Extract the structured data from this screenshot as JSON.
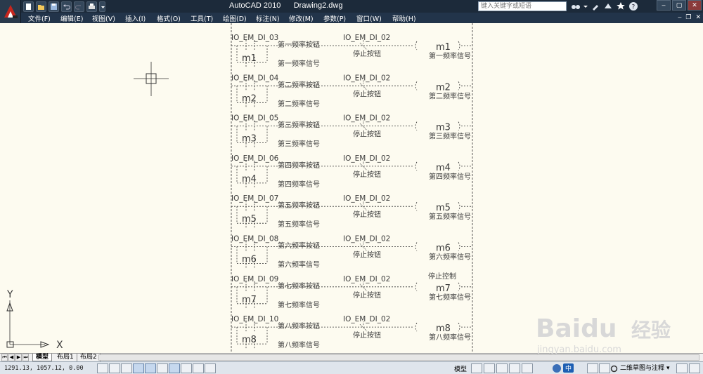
{
  "titlebar": {
    "app_name": "AutoCAD 2010",
    "document": "Drawing2.dwg",
    "search_placeholder": "键入关键字或短语"
  },
  "menu": [
    "文件(F)",
    "编辑(E)",
    "视图(V)",
    "插入(I)",
    "格式(O)",
    "工具(T)",
    "绘图(D)",
    "标注(N)",
    "修改(M)",
    "参数(P)",
    "窗口(W)",
    "帮助(H)"
  ],
  "ucs": {
    "x_label": "X",
    "y_label": "Y"
  },
  "ladder": {
    "rows": [
      {
        "tag": "IO_EM_DI_03",
        "button": "第一频率按钮",
        "stop_tag": "IO_EM_DI_02",
        "stop_label": "停止按钮",
        "coil": "m1",
        "coil_label": "第一频率信号",
        "hold": "m1",
        "hold_label": "第一频率信号",
        "extra": ""
      },
      {
        "tag": "IO_EM_DI_04",
        "button": "第二频率按钮",
        "stop_tag": "IO_EM_DI_02",
        "stop_label": "停止按钮",
        "coil": "m2",
        "coil_label": "第二频率信号",
        "hold": "m2",
        "hold_label": "第二频率信号",
        "extra": ""
      },
      {
        "tag": "IO_EM_DI_05",
        "button": "第三频率按钮",
        "stop_tag": "IO_EM_DI_02",
        "stop_label": "停止按钮",
        "coil": "m3",
        "coil_label": "第三频率信号",
        "hold": "m3",
        "hold_label": "第三频率信号",
        "extra": ""
      },
      {
        "tag": "IO_EM_DI_06",
        "button": "第四频率按钮",
        "stop_tag": "IO_EM_DI_02",
        "stop_label": "停止按钮",
        "coil": "m4",
        "coil_label": "第四频率信号",
        "hold": "m4",
        "hold_label": "第四频率信号",
        "extra": ""
      },
      {
        "tag": "IO_EM_DI_07",
        "button": "第五频率按钮",
        "stop_tag": "IO_EM_DI_02",
        "stop_label": "停止按钮",
        "coil": "m5",
        "coil_label": "第五频率信号",
        "hold": "m5",
        "hold_label": "第五频率信号",
        "extra": ""
      },
      {
        "tag": "IO_EM_DI_08",
        "button": "第六频率按钮",
        "stop_tag": "IO_EM_DI_02",
        "stop_label": "停止按钮",
        "coil": "m6",
        "coil_label": "第六频率信号",
        "hold": "m6",
        "hold_label": "第六频率信号",
        "extra": ""
      },
      {
        "tag": "IO_EM_DI_09",
        "button": "第七频率按钮",
        "stop_tag": "IO_EM_DI_02",
        "stop_label": "停止按钮",
        "coil": "m7",
        "coil_label": "第七频率信号",
        "hold": "m7",
        "hold_label": "第七频率信号",
        "extra": "停止控制"
      },
      {
        "tag": "IO_EM_DI_10",
        "button": "第八频率按钮",
        "stop_tag": "IO_EM_DI_02",
        "stop_label": "停止按钮",
        "coil": "m8",
        "coil_label": "第八频率信号",
        "hold": "m8",
        "hold_label": "第八频率信号",
        "extra": ""
      }
    ]
  },
  "tabs": {
    "model": "模型",
    "layout1": "布局1",
    "layout2": "布局2"
  },
  "status": {
    "coords": "1291.13, 1057.12, 0.00",
    "model_label": "模型",
    "ime": "中",
    "workspace": "二维草图与注释"
  },
  "watermark": {
    "brand": "Baidu",
    "brand_cn": "经验",
    "url": "jingyan.baidu.com"
  }
}
